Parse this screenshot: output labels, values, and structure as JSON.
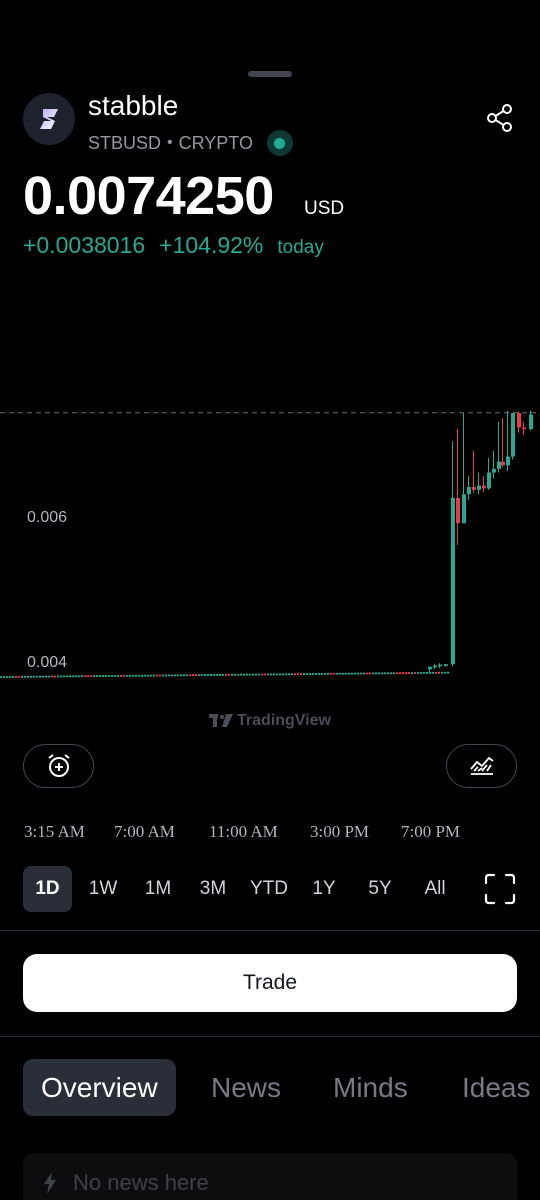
{
  "header": {
    "name": "stabble",
    "symbol": "STBUSD",
    "separator": "•",
    "market": "CRYPTO"
  },
  "quote": {
    "price": "0.0074250",
    "currency": "USD",
    "change_abs": "+0.0038016",
    "change_pct": "+104.92%",
    "period": "today"
  },
  "chart_data": {
    "type": "candlestick",
    "y_ticks": [
      "0.006",
      "0.004"
    ],
    "x_ticks": [
      "3:15 AM",
      "7:00 AM",
      "11:00 AM",
      "3:00 PM",
      "7:00 PM"
    ],
    "last_price_line": 0.007425,
    "approx_series": [
      {
        "phase": "flat",
        "from": "3:15 AM",
        "to": "7:00 PM",
        "level": 0.00378
      },
      {
        "phase": "spike",
        "time": "after 7:00 PM",
        "low": 0.00395,
        "high": 0.00742
      },
      {
        "phase": "close",
        "level": 0.00742
      }
    ],
    "up_color": "#22ab94",
    "down_color": "#f23645",
    "watermark": "TradingView"
  },
  "controls": {
    "alert_icon": "alarm-plus-icon",
    "indicator_icon": "chart-area-icon"
  },
  "ranges": [
    "1D",
    "1W",
    "1M",
    "3M",
    "YTD",
    "1Y",
    "5Y",
    "All"
  ],
  "active_range": "1D",
  "trade_label": "Trade",
  "tabs": [
    "Overview",
    "News",
    "Minds",
    "Ideas"
  ],
  "active_tab": "Overview",
  "news_empty": "No news here",
  "colors": {
    "accent": "#22ab94",
    "negative": "#f23645",
    "background": "#000000"
  }
}
